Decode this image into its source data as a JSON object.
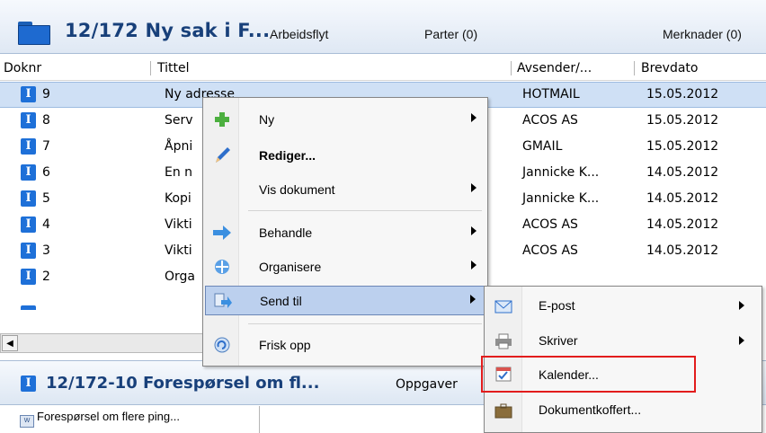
{
  "header": {
    "case_title": "12/172 Ny sak i F...",
    "tabs": [
      "Arbeidsflyt",
      "Parter (0)",
      "Merknader (0)"
    ]
  },
  "columns": [
    "Doknr",
    "Tittel",
    "Avsender/...",
    "Brevdato"
  ],
  "rows": [
    {
      "icon": "I",
      "num": "9",
      "title": "Ny adresse",
      "sender": "HOTMAIL",
      "date": "15.05.2012"
    },
    {
      "icon": "I",
      "num": "8",
      "title": "Serv",
      "sender": "ACOS AS",
      "date": "15.05.2012"
    },
    {
      "icon": "I",
      "num": "7",
      "title": "Åpni",
      "sender": "GMAIL",
      "date": "15.05.2012"
    },
    {
      "icon": "I",
      "num": "6",
      "title": "En n",
      "sender": "Jannicke K...",
      "date": "14.05.2012"
    },
    {
      "icon": "I",
      "num": "5",
      "title": "Kopi",
      "sender": "Jannicke K...",
      "date": "14.05.2012"
    },
    {
      "icon": "I",
      "num": "4",
      "title": "Vikti",
      "sender": "ACOS AS",
      "date": "14.05.2012"
    },
    {
      "icon": "I",
      "num": "3",
      "title": "Vikti",
      "sender": "ACOS AS",
      "date": "14.05.2012"
    },
    {
      "icon": "I",
      "num": "2",
      "title": "Orga",
      "sender": "",
      "date": ""
    }
  ],
  "context_menu": {
    "items": [
      {
        "label": "Ny",
        "submenu": true,
        "icon": "green-plus-icon"
      },
      {
        "label": "Rediger...",
        "bold": true,
        "icon": "pencil-icon"
      },
      {
        "label": "Vis dokument",
        "submenu": true
      },
      {
        "label": "Behandle",
        "submenu": true,
        "icon": "blue-arrow-icon"
      },
      {
        "label": "Organisere",
        "submenu": true,
        "icon": "move-arrows-icon"
      },
      {
        "label": "Send til",
        "submenu": true,
        "icon": "send-to-icon",
        "highlighted": true
      },
      {
        "label": "Frisk opp",
        "icon": "refresh-icon"
      }
    ]
  },
  "send_to_menu": {
    "items": [
      {
        "label": "E-post",
        "submenu": true,
        "icon": "email-icon"
      },
      {
        "label": "Skriver",
        "submenu": true,
        "icon": "printer-icon"
      },
      {
        "label": "Kalender...",
        "icon": "calendar-icon",
        "highlighted": true
      },
      {
        "label": "Dokumentkoffert...",
        "icon": "briefcase-icon"
      }
    ]
  },
  "subpane": {
    "icon": "I",
    "title": "12/172-10 Forespørsel om fl...",
    "tab": "Oppgaver"
  },
  "attachment": {
    "label": "Forespørsel om flere ping..."
  },
  "colors": {
    "accent": "#1e70d8",
    "title": "#18407a",
    "highlight_box": "#e21c1c"
  }
}
